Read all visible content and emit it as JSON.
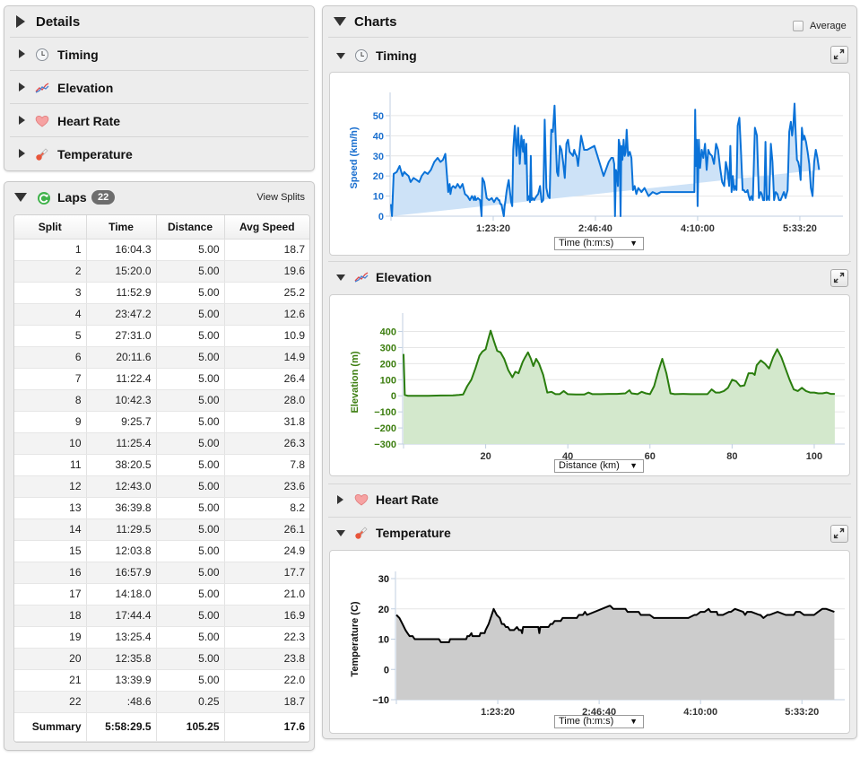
{
  "details": {
    "title": "Details",
    "items": [
      {
        "label": "Timing",
        "icon": "clock-icon"
      },
      {
        "label": "Elevation",
        "icon": "elevation-graph-icon"
      },
      {
        "label": "Heart Rate",
        "icon": "heart-icon"
      },
      {
        "label": "Temperature",
        "icon": "thermometer-icon"
      }
    ]
  },
  "laps": {
    "title": "Laps",
    "count": "22",
    "icon": "refresh-laps-icon",
    "view_splits_label": "View Splits",
    "columns": [
      "Split",
      "Time",
      "Distance",
      "Avg Speed"
    ],
    "rows": [
      [
        "1",
        "16:04.3",
        "5.00",
        "18.7"
      ],
      [
        "2",
        "15:20.0",
        "5.00",
        "19.6"
      ],
      [
        "3",
        "11:52.9",
        "5.00",
        "25.2"
      ],
      [
        "4",
        "23:47.2",
        "5.00",
        "12.6"
      ],
      [
        "5",
        "27:31.0",
        "5.00",
        "10.9"
      ],
      [
        "6",
        "20:11.6",
        "5.00",
        "14.9"
      ],
      [
        "7",
        "11:22.4",
        "5.00",
        "26.4"
      ],
      [
        "8",
        "10:42.3",
        "5.00",
        "28.0"
      ],
      [
        "9",
        "9:25.7",
        "5.00",
        "31.8"
      ],
      [
        "10",
        "11:25.4",
        "5.00",
        "26.3"
      ],
      [
        "11",
        "38:20.5",
        "5.00",
        "7.8"
      ],
      [
        "12",
        "12:43.0",
        "5.00",
        "23.6"
      ],
      [
        "13",
        "36:39.8",
        "5.00",
        "8.2"
      ],
      [
        "14",
        "11:29.5",
        "5.00",
        "26.1"
      ],
      [
        "15",
        "12:03.8",
        "5.00",
        "24.9"
      ],
      [
        "16",
        "16:57.9",
        "5.00",
        "17.7"
      ],
      [
        "17",
        "14:18.0",
        "5.00",
        "21.0"
      ],
      [
        "18",
        "17:44.4",
        "5.00",
        "16.9"
      ],
      [
        "19",
        "13:25.4",
        "5.00",
        "22.3"
      ],
      [
        "20",
        "12:35.8",
        "5.00",
        "23.8"
      ],
      [
        "21",
        "13:39.9",
        "5.00",
        "22.0"
      ],
      [
        "22",
        ":48.6",
        "0.25",
        "18.7"
      ]
    ],
    "summary": [
      "Summary",
      "5:58:29.5",
      "105.25",
      "17.6"
    ]
  },
  "charts": {
    "title": "Charts",
    "average_label": "Average",
    "average_checked": false,
    "sections": {
      "timing": {
        "label": "Timing",
        "select_value": "Time (h:m:s)"
      },
      "elevation": {
        "label": "Elevation",
        "select_value": "Distance (km)"
      },
      "heart_rate": {
        "label": "Heart Rate"
      },
      "temperature": {
        "label": "Temperature",
        "select_value": "Time (h:m:s)"
      }
    },
    "colors": {
      "speed_line": "#0a72d8",
      "speed_fill": "#cde2f7",
      "speed_axis_text": "#1a6fcf",
      "elevation_line": "#2a7d0e",
      "elevation_fill": "#d3e8cc",
      "elevation_axis_text": "#3b7d0e",
      "temp_line": "#000000",
      "temp_fill": "#cccccc"
    }
  },
  "chart_data": [
    {
      "type": "area",
      "title": "Timing",
      "xlabel": "Time (h:m:s)",
      "ylabel": "Speed (km/h)",
      "xlim": [
        0,
        21670
      ],
      "ylim": [
        0,
        58
      ],
      "yticks": [
        0,
        10,
        20,
        30,
        40,
        50
      ],
      "xticks": [
        {
          "v": 5000,
          "label": "1:23:20"
        },
        {
          "v": 10000,
          "label": "2:46:40"
        },
        {
          "v": 15000,
          "label": "4:10:00"
        },
        {
          "v": 20000,
          "label": "5:33:20"
        }
      ],
      "x": [
        0,
        50,
        130,
        280,
        420,
        560,
        650,
        740,
        860,
        960,
        1100,
        1260,
        1380,
        1500,
        1650,
        1800,
        1950,
        2120,
        2280,
        2420,
        2540,
        2660,
        2800,
        2870,
        2910,
        2960,
        3040,
        3150,
        3260,
        3380,
        3500,
        3620,
        3740,
        3860,
        3960,
        4060,
        4100,
        4160,
        4250,
        4360,
        4430,
        4470,
        4560,
        4680,
        4800,
        4930,
        5040,
        5150,
        5200,
        5260,
        5300,
        5350,
        5400,
        5440,
        5480,
        5520,
        5560,
        5600,
        5650,
        5700,
        5760,
        5820,
        5880,
        5930,
        5980,
        6060,
        6140,
        6220,
        6300,
        6380,
        6460,
        6500,
        6560,
        6620,
        6680,
        6750,
        6800,
        6840,
        6880,
        6940,
        7000,
        7060,
        7120,
        7200,
        7290,
        7370,
        7450,
        7520,
        7600,
        7680,
        7760,
        7840,
        7920,
        8000,
        8060,
        8120,
        8180,
        8260,
        8340,
        8420,
        8500,
        8580,
        8660,
        8740,
        8820,
        8900,
        8960,
        9020,
        9080,
        9150,
        9300,
        9450,
        9600,
        9950,
        10400,
        10650,
        10780,
        10860,
        10920,
        10960,
        11000,
        11050,
        11100,
        11140,
        11180,
        11230,
        11270,
        11320,
        11380,
        11430,
        11480,
        11530,
        11600,
        11680,
        11760,
        11840,
        11920,
        12000,
        12100,
        12250,
        12400,
        12600,
        12800,
        13000,
        13200,
        14300,
        14700,
        14760,
        14800,
        14840,
        14880,
        14920,
        14960,
        15000,
        15060,
        15120,
        15200,
        15280,
        15360,
        15440,
        15520,
        15600,
        15700,
        15800,
        15900,
        16000,
        16100,
        16200,
        16300,
        16380,
        16460,
        16540,
        16600,
        16660,
        16720,
        16780,
        16840,
        16900,
        16960,
        17040,
        17120,
        17200,
        17260,
        17320,
        17380,
        17440,
        17500,
        17560,
        17620,
        17700,
        17800,
        17900,
        18000,
        18080,
        18140,
        18200,
        18260,
        18320,
        18380,
        18440,
        18500,
        18580,
        18660,
        18740,
        18820,
        18900,
        18980,
        19060,
        19140,
        19220,
        19300,
        19400,
        19480,
        19560,
        19620,
        19680,
        19740,
        19800,
        19860,
        19920,
        19980,
        20040,
        20100,
        20160,
        20220,
        20300,
        20380,
        20460,
        20540,
        20620,
        20700,
        20780,
        20860,
        20940,
        21020,
        21100,
        21180,
        21260,
        21340,
        21420,
        21500,
        21600
      ],
      "values": [
        6,
        0,
        21,
        22,
        25,
        20,
        22,
        21,
        20,
        17,
        19,
        18,
        17,
        20,
        22,
        21,
        23,
        27,
        29,
        27,
        28,
        31,
        12,
        16,
        11,
        14,
        15,
        14,
        16,
        14,
        16,
        11,
        10,
        8,
        10,
        8,
        10,
        8,
        9,
        8,
        0,
        19,
        17,
        9,
        8,
        9,
        7,
        9,
        9,
        8,
        8,
        6,
        6,
        4,
        2,
        0,
        5,
        8,
        12,
        15,
        18,
        12,
        7,
        5,
        33,
        45,
        30,
        44,
        26,
        40,
        32,
        38,
        26,
        36,
        8,
        10,
        7,
        30,
        8,
        9,
        8,
        9,
        10,
        11,
        15,
        7,
        8,
        48,
        14,
        10,
        9,
        43,
        42,
        55,
        38,
        22,
        20,
        35,
        33,
        27,
        19,
        36,
        38,
        32,
        31,
        30,
        33,
        31,
        30,
        25,
        40,
        33,
        33,
        35,
        20,
        27,
        29,
        29,
        26,
        0,
        23,
        21,
        15,
        38,
        36,
        0,
        35,
        28,
        38,
        30,
        32,
        43,
        30,
        32,
        29,
        13,
        15,
        11,
        14,
        12,
        14,
        10,
        12,
        11,
        12,
        12,
        12,
        12,
        12,
        12,
        53,
        25,
        38,
        5,
        38,
        24,
        33,
        29,
        36,
        23,
        33,
        31,
        30,
        26,
        36,
        33,
        24,
        17,
        15,
        27,
        23,
        15,
        35,
        12,
        20,
        13,
        15,
        13,
        45,
        49,
        32,
        13,
        13,
        12,
        12,
        13,
        10,
        8,
        10,
        8,
        44,
        40,
        9,
        12,
        11,
        8,
        8,
        37,
        8,
        10,
        8,
        36,
        27,
        8,
        12,
        11,
        8,
        8,
        10,
        12,
        9,
        13,
        42,
        47,
        40,
        45,
        56,
        40,
        28,
        27,
        24,
        18,
        44,
        38,
        40,
        37,
        32,
        26,
        14,
        10,
        27,
        33,
        29,
        23
      ]
    },
    {
      "type": "area",
      "title": "Elevation",
      "xlabel": "Distance (km)",
      "ylabel": "Elevation (m)",
      "xlim": [
        0,
        105.25
      ],
      "ylim": [
        -300,
        470
      ],
      "yticks": [
        -300,
        -200,
        -100,
        0,
        100,
        200,
        300,
        400
      ],
      "xticks": [
        {
          "v": 20,
          "label": "20"
        },
        {
          "v": 40,
          "label": "40"
        },
        {
          "v": 60,
          "label": "60"
        },
        {
          "v": 80,
          "label": "80"
        },
        {
          "v": 100,
          "label": "100"
        }
      ],
      "x": [
        0,
        0.3,
        1,
        3,
        6,
        9,
        12,
        13.5,
        14.5,
        15.5,
        16.5,
        17.5,
        18.5,
        19.2,
        20,
        20.5,
        21.2,
        22,
        22.8,
        23.6,
        24.5,
        25.5,
        26.5,
        27.2,
        28,
        29,
        29.6,
        30.3,
        31,
        31.6,
        32.3,
        33,
        34,
        35,
        36,
        37,
        38,
        39,
        40,
        42,
        44,
        45,
        46,
        48,
        50,
        52,
        54,
        55,
        55.5,
        57,
        58,
        59,
        60,
        61,
        62,
        63,
        64,
        65,
        66,
        68,
        70,
        72,
        74,
        75,
        76,
        77,
        78,
        79,
        80,
        81,
        82,
        83,
        84,
        85,
        85.5,
        86,
        87,
        88,
        89,
        90,
        91,
        92,
        93,
        94,
        95,
        96,
        97,
        98,
        99,
        100,
        101,
        102,
        103,
        104,
        105
      ],
      "values": [
        260,
        5,
        0,
        0,
        0,
        2,
        3,
        5,
        8,
        60,
        100,
        170,
        250,
        275,
        290,
        340,
        405,
        340,
        280,
        270,
        230,
        160,
        115,
        150,
        140,
        210,
        240,
        270,
        230,
        185,
        230,
        200,
        130,
        20,
        25,
        10,
        10,
        30,
        10,
        8,
        8,
        20,
        10,
        10,
        12,
        12,
        15,
        35,
        15,
        10,
        25,
        15,
        10,
        60,
        150,
        230,
        140,
        15,
        10,
        12,
        10,
        10,
        10,
        40,
        20,
        20,
        30,
        50,
        100,
        90,
        60,
        65,
        140,
        140,
        130,
        190,
        220,
        200,
        170,
        240,
        290,
        240,
        170,
        100,
        40,
        30,
        50,
        30,
        20,
        20,
        15,
        15,
        20,
        12,
        12
      ],
      "grid": true
    },
    {
      "type": "area",
      "title": "Temperature",
      "xlabel": "Time (h:m:s)",
      "ylabel": "Temperature (C)",
      "xlim": [
        0,
        21670
      ],
      "ylim": [
        -10,
        30
      ],
      "yticks": [
        -10,
        0,
        10,
        20,
        30
      ],
      "xticks": [
        {
          "v": 5000,
          "label": "1:23:20"
        },
        {
          "v": 10000,
          "label": "2:46:40"
        },
        {
          "v": 15000,
          "label": "4:10:00"
        },
        {
          "v": 20000,
          "label": "5:33:20"
        }
      ],
      "x": [
        0,
        150,
        300,
        450,
        550,
        650,
        800,
        900,
        1000,
        1250,
        1500,
        1800,
        2100,
        2200,
        2350,
        2600,
        2650,
        2900,
        3200,
        3450,
        3500,
        3600,
        3700,
        3750,
        3800,
        4100,
        4150,
        4350,
        4400,
        4550,
        4700,
        4800,
        4950,
        5100,
        5200,
        5300,
        5400,
        5500,
        5600,
        5650,
        5800,
        5950,
        6050,
        6150,
        6200,
        6250,
        6400,
        6700,
        6900,
        7000,
        7050,
        7100,
        7500,
        7600,
        7700,
        7800,
        8100,
        8200,
        8400,
        8600,
        8800,
        8900,
        9000,
        9100,
        9200,
        9300,
        9400,
        10500,
        10550,
        10700,
        11000,
        11300,
        11400,
        11700,
        11850,
        11950,
        12050,
        12150,
        12250,
        12500,
        12700,
        14300,
        14400,
        14700,
        14800,
        15000,
        15200,
        15400,
        15500,
        15800,
        15850,
        16100,
        16400,
        16500,
        16700,
        17100,
        17200,
        17300,
        17500,
        17900,
        17950,
        18100,
        18300,
        18400,
        18800,
        19200,
        19300,
        19500,
        19600,
        19700,
        19900,
        20100,
        20300,
        20500,
        20600,
        20800,
        21000,
        21200,
        21600
      ],
      "values": [
        18,
        17,
        15,
        13,
        12,
        11,
        11,
        10,
        10,
        10,
        10,
        10,
        10,
        9,
        9,
        9,
        10,
        10,
        10,
        10,
        11,
        11,
        12,
        11,
        11,
        11,
        12,
        12,
        13,
        15,
        18,
        20,
        18,
        17,
        15,
        15,
        14,
        14,
        13,
        13,
        13,
        14,
        13,
        13,
        12,
        14,
        14,
        14,
        14,
        14,
        12,
        14,
        14,
        15,
        15,
        16,
        16,
        17,
        17,
        17,
        17,
        17,
        18,
        18,
        18,
        19,
        18,
        21,
        21,
        20,
        20,
        20,
        19,
        19,
        19,
        19,
        18,
        18,
        18,
        18,
        17,
        17,
        17,
        18,
        18,
        19,
        19,
        20,
        19,
        19,
        18,
        18,
        19,
        19,
        20,
        19,
        18,
        19,
        19,
        18,
        18,
        17,
        18,
        18,
        19,
        18,
        18,
        18,
        18,
        19,
        19,
        18,
        18,
        18,
        18,
        19,
        20,
        20,
        19,
        19,
        20
      ]
    }
  ]
}
